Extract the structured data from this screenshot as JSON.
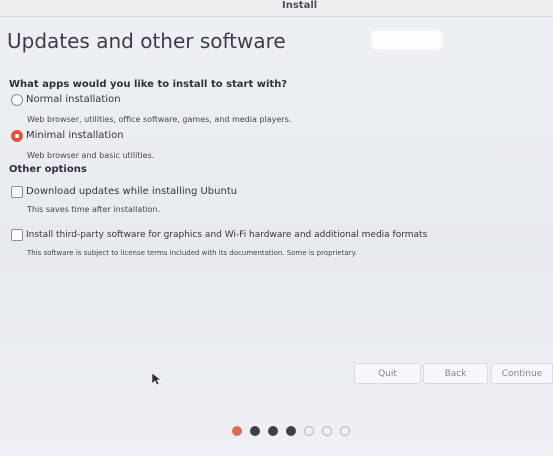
{
  "window": {
    "title": "Install"
  },
  "page": {
    "title": "Updates and other software"
  },
  "question": "What apps would you like to install to start with?",
  "options": [
    {
      "label": "Normal installation",
      "description": "Web browser, utilities, office software, games, and media players.",
      "selected": false
    },
    {
      "label": "Minimal installation",
      "description": "Web browser and basic utilities.",
      "selected": true
    }
  ],
  "other_options": {
    "heading": "Other options",
    "items": [
      {
        "label": "Download updates while installing Ubuntu",
        "description": "This saves time after installation.",
        "checked": false
      },
      {
        "label": "Install third-party software for graphics and Wi-Fi hardware and additional media formats",
        "description": "This software is subject to license terms included with its documentation. Some is proprietary.",
        "checked": false
      }
    ]
  },
  "buttons": {
    "quit": "Quit",
    "back": "Back",
    "continue": "Continue"
  },
  "progress": {
    "total_steps": 7,
    "current_step": 1,
    "completed_steps": 3
  },
  "colors": {
    "accent": "#e0543c",
    "step_done": "#3e4047",
    "step_current": "#e06d53"
  },
  "icons": {
    "pointer": "mouse-pointer-icon"
  }
}
